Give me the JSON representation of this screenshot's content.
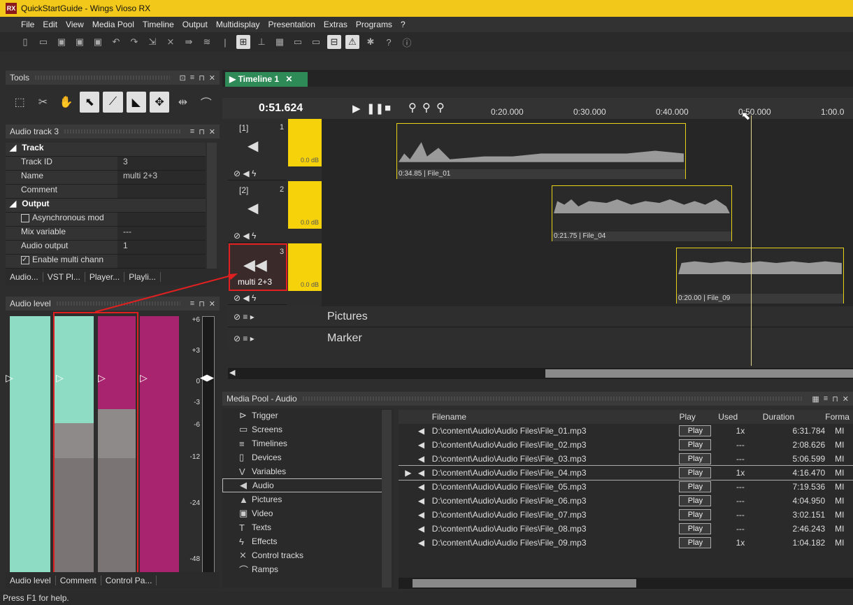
{
  "window": {
    "title": "QuickStartGuide - Wings Vioso RX",
    "logo": "RX"
  },
  "menu": [
    "File",
    "Edit",
    "View",
    "Media Pool",
    "Timeline",
    "Output",
    "Multidisplay",
    "Presentation",
    "Extras",
    "Programs",
    "?"
  ],
  "tools_panel": {
    "title": "Tools"
  },
  "props_panel": {
    "title": "Audio track 3",
    "sections": [
      {
        "label": "Track",
        "rows": [
          [
            "Track ID",
            "3"
          ],
          [
            "Name",
            "multi 2+3"
          ],
          [
            "Comment",
            ""
          ]
        ]
      },
      {
        "label": "Output",
        "rows": [
          [
            "Asynchronous mod",
            ""
          ],
          [
            "Mix variable",
            "---"
          ],
          [
            "Audio output",
            "1"
          ],
          [
            "Enable multi chann",
            ""
          ]
        ]
      }
    ],
    "tabs": [
      "Audio...",
      "VST Pl...",
      "Player...",
      "Playli..."
    ]
  },
  "audio_level": {
    "title": "Audio level",
    "scale": [
      "+6",
      "+3",
      "0",
      "-3",
      "-6",
      "-12",
      "-24",
      "-48"
    ],
    "tabs": [
      "Audio level",
      "Comment",
      "Control Pa..."
    ]
  },
  "timeline": {
    "tab": "Timeline 1",
    "time": "0:51.624",
    "ticks": [
      "0:20.000",
      "0:30.000",
      "0:40.000",
      "0:50.000",
      "1:00.0"
    ],
    "tracks": [
      {
        "id": "[1]",
        "num": "1",
        "gain": "0.0 dB",
        "clip": "0:34.85 | File_01"
      },
      {
        "id": "[2]",
        "num": "2",
        "gain": "0.0 dB",
        "clip": "0:21.75 | File_04"
      },
      {
        "id": "",
        "num": "3",
        "name": "multi 2+3",
        "gain": "0.0 dB",
        "clip": "0:20.00 | File_09"
      }
    ],
    "pictures": "Pictures",
    "marker": "Marker"
  },
  "media_pool": {
    "title": "Media Pool - Audio",
    "categories": [
      "Trigger",
      "Screens",
      "Timelines",
      "Devices",
      "Variables",
      "Audio",
      "Pictures",
      "Video",
      "Texts",
      "Effects",
      "Control tracks",
      "Ramps"
    ],
    "columns": [
      "Filename",
      "Play",
      "Used",
      "Duration",
      "Forma"
    ],
    "rows": [
      {
        "file": "D:\\content\\Audio\\Audio Files\\File_01.mp3",
        "play": "Play",
        "used": "1x",
        "dur": "6:31.784",
        "fmt": "MI"
      },
      {
        "file": "D:\\content\\Audio\\Audio Files\\File_02.mp3",
        "play": "Play",
        "used": "---",
        "dur": "2:08.626",
        "fmt": "MI"
      },
      {
        "file": "D:\\content\\Audio\\Audio Files\\File_03.mp3",
        "play": "Play",
        "used": "---",
        "dur": "5:06.599",
        "fmt": "MI"
      },
      {
        "file": "D:\\content\\Audio\\Audio Files\\File_04.mp3",
        "play": "Play",
        "used": "1x",
        "dur": "4:16.470",
        "fmt": "MI"
      },
      {
        "file": "D:\\content\\Audio\\Audio Files\\File_05.mp3",
        "play": "Play",
        "used": "---",
        "dur": "7:19.536",
        "fmt": "MI"
      },
      {
        "file": "D:\\content\\Audio\\Audio Files\\File_06.mp3",
        "play": "Play",
        "used": "---",
        "dur": "4:04.950",
        "fmt": "MI"
      },
      {
        "file": "D:\\content\\Audio\\Audio Files\\File_07.mp3",
        "play": "Play",
        "used": "---",
        "dur": "3:02.151",
        "fmt": "MI"
      },
      {
        "file": "D:\\content\\Audio\\Audio Files\\File_08.mp3",
        "play": "Play",
        "used": "---",
        "dur": "2:46.243",
        "fmt": "MI"
      },
      {
        "file": "D:\\content\\Audio\\Audio Files\\File_09.mp3",
        "play": "Play",
        "used": "1x",
        "dur": "1:04.182",
        "fmt": "MI"
      }
    ]
  },
  "status": "Press F1 for help.",
  "colors": {
    "titlebar": "#f2c81a",
    "accent_yellow": "#f5d20a",
    "meter_teal": "#8fdcc4",
    "meter_magenta": "#a8246e",
    "highlight_red": "#e02020"
  }
}
